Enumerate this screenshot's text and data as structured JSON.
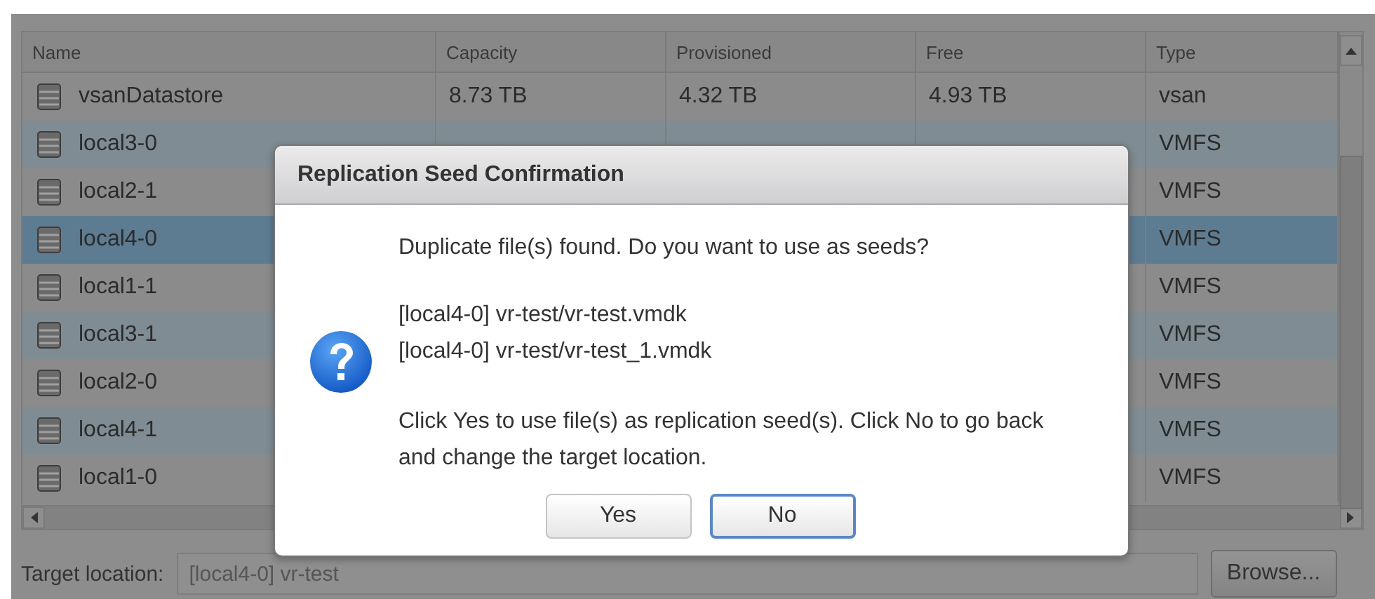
{
  "table": {
    "columns": [
      "Name",
      "Capacity",
      "Provisioned",
      "Free",
      "Type"
    ],
    "rows": [
      {
        "name": "vsanDatastore",
        "capacity": "8.73 TB",
        "provisioned": "4.32 TB",
        "free": "4.93 TB",
        "type": "vsan",
        "selected": false
      },
      {
        "name": "local3-0",
        "type": "VMFS",
        "selected": false
      },
      {
        "name": "local2-1",
        "type": "VMFS",
        "selected": false
      },
      {
        "name": "local4-0",
        "type": "VMFS",
        "selected": true
      },
      {
        "name": "local1-1",
        "type": "VMFS",
        "selected": false
      },
      {
        "name": "local3-1",
        "type": "VMFS",
        "selected": false
      },
      {
        "name": "local2-0",
        "type": "VMFS",
        "selected": false
      },
      {
        "name": "local4-1",
        "type": "VMFS",
        "selected": false
      },
      {
        "name": "local1-0",
        "type": "VMFS",
        "selected": false
      }
    ]
  },
  "target_location": {
    "label": "Target location:",
    "value": "[local4-0] vr-test"
  },
  "browse_button": "Browse...",
  "dialog": {
    "title": "Replication Seed Confirmation",
    "message": "Duplicate file(s) found. Do you want to use as seeds?",
    "files": [
      "[local4-0] vr-test/vr-test.vmdk",
      "[local4-0] vr-test/vr-test_1.vmdk"
    ],
    "instruction": "Click Yes to use file(s) as replication seed(s). Click No to go back and change the target location.",
    "buttons": [
      {
        "label": "Yes",
        "focused": false
      },
      {
        "label": "No",
        "focused": true
      }
    ]
  }
}
